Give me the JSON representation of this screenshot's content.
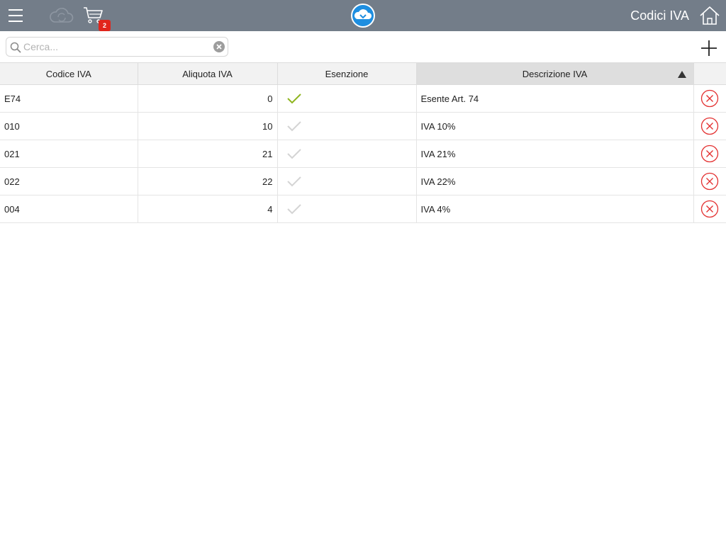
{
  "header": {
    "title": "Codici IVA",
    "cart_count": "2",
    "colors": {
      "bar": "#737d89",
      "logo": "#1e8ee0",
      "badge": "#e1251b"
    },
    "icons": [
      "menu-icon",
      "cloud-sync-icon",
      "cart-icon",
      "cloud-logo-icon",
      "home-icon"
    ]
  },
  "search": {
    "placeholder": "Cerca...",
    "value": ""
  },
  "toolbar": {
    "add_icon": "plus-icon"
  },
  "table": {
    "columns": [
      "Codice IVA",
      "Aliquota IVA",
      "Esenzione",
      "Descrizione IVA",
      ""
    ],
    "sort": {
      "column": "Descrizione IVA",
      "direction": "ascending"
    },
    "rows": [
      {
        "codice": "E74",
        "aliquota": "0",
        "esenzione": true,
        "descrizione": "Esente Art. 74"
      },
      {
        "codice": "010",
        "aliquota": "10",
        "esenzione": false,
        "descrizione": "IVA 10%"
      },
      {
        "codice": "021",
        "aliquota": "21",
        "esenzione": false,
        "descrizione": "IVA 21%"
      },
      {
        "codice": "022",
        "aliquota": "22",
        "esenzione": false,
        "descrizione": "IVA 22%"
      },
      {
        "codice": "004",
        "aliquota": "4",
        "esenzione": false,
        "descrizione": "IVA 4%"
      }
    ],
    "colors": {
      "check_on": "#8fb51f",
      "check_off": "#d4d4d4",
      "delete": "#e33030"
    }
  }
}
